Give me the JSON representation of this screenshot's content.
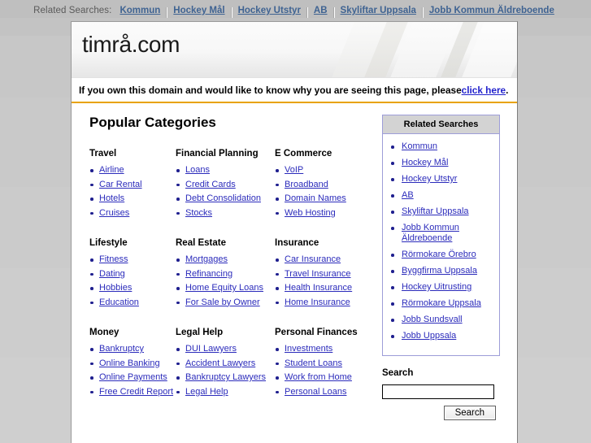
{
  "topbar": {
    "label": "Related Searches:",
    "links": [
      "Kommun",
      "Hockey Mål",
      "Hockey Utstyr",
      "AB",
      "Skyliftar Uppsala",
      "Jobb Kommun Äldreboende"
    ]
  },
  "header": {
    "domain": "timrå.com"
  },
  "notice": {
    "text_before": "If you own this domain and would like to know why you are seeing this page, please ",
    "link": "click here",
    "text_after": ".",
    "rule_color": "#e8a200"
  },
  "main": {
    "popular_title": "Popular Categories",
    "categories": [
      {
        "title": "Travel",
        "items": [
          "Airline",
          "Car Rental",
          "Hotels",
          "Cruises"
        ]
      },
      {
        "title": "Financial Planning",
        "items": [
          "Loans",
          "Credit Cards",
          "Debt Consolidation",
          "Stocks"
        ]
      },
      {
        "title": "E Commerce",
        "items": [
          "VoIP",
          "Broadband",
          "Domain Names",
          "Web Hosting"
        ]
      },
      {
        "title": "Lifestyle",
        "items": [
          "Fitness",
          "Dating",
          "Hobbies",
          "Education"
        ]
      },
      {
        "title": "Real Estate",
        "items": [
          "Mortgages",
          "Refinancing",
          "Home Equity Loans",
          "For Sale by Owner"
        ]
      },
      {
        "title": "Insurance",
        "items": [
          "Car Insurance",
          "Travel Insurance",
          "Health Insurance",
          "Home Insurance"
        ]
      },
      {
        "title": "Money",
        "items": [
          "Bankruptcy",
          "Online Banking",
          "Online Payments",
          "Free Credit Report"
        ]
      },
      {
        "title": "Legal Help",
        "items": [
          "DUI Lawyers",
          "Accident Lawyers",
          "Bankruptcy Lawyers",
          "Legal Help"
        ]
      },
      {
        "title": "Personal Finances",
        "items": [
          "Investments",
          "Student Loans",
          "Work from Home",
          "Personal Loans"
        ]
      }
    ]
  },
  "sidebar": {
    "title": "Related Searches",
    "items": [
      "Kommun",
      "Hockey Mål",
      "Hockey Utstyr",
      "AB",
      "Skyliftar Uppsala",
      "Jobb Kommun Äldreboende",
      "Rörmokare Örebro",
      "Byggfirma Uppsala",
      "Hockey Uitrusting",
      "Rörmokare Uppsala",
      "Jobb Sundsvall",
      "Jobb Uppsala"
    ]
  },
  "search": {
    "label": "Search",
    "value": "",
    "placeholder": "",
    "button": "Search"
  },
  "colors": {
    "link": "#2b2bbb",
    "topbar_link": "#3f6392",
    "accent_rule": "#e8a200",
    "panel_border": "#9d9dd8",
    "panel_head_bg": "#d3d3d3"
  }
}
